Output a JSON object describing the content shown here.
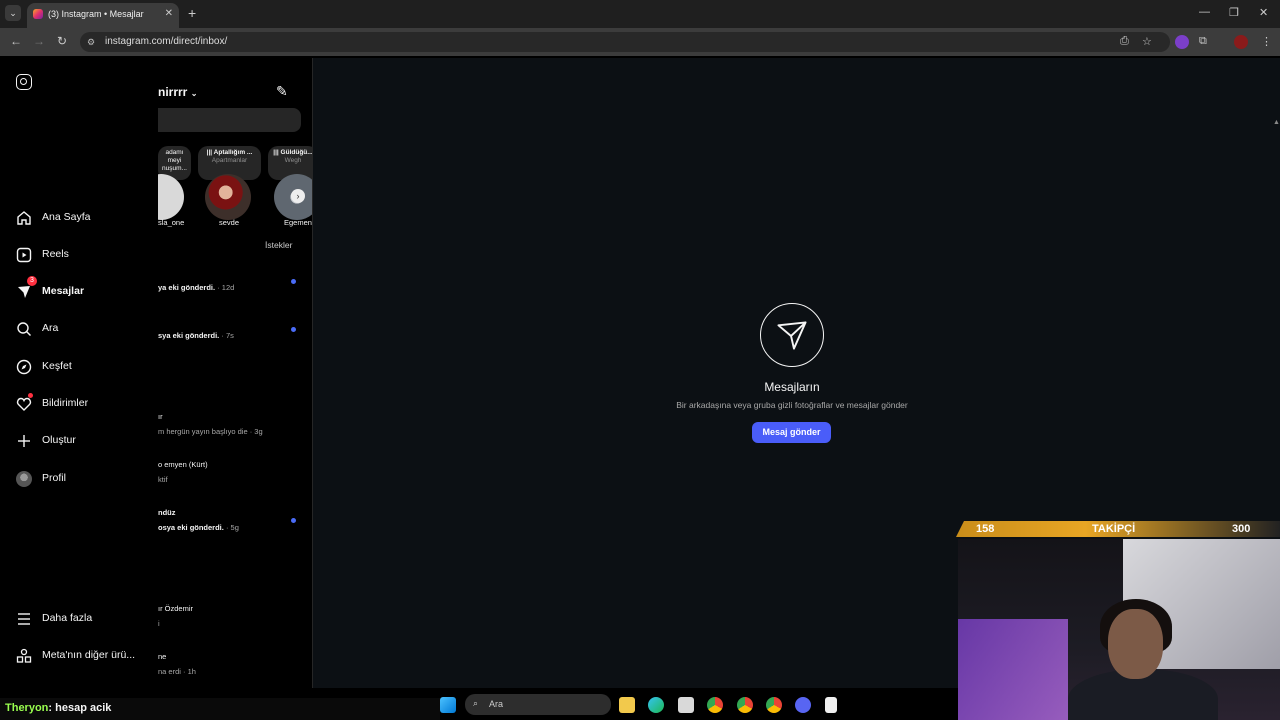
{
  "browser": {
    "tab_title": "(3) Instagram • Mesajlar",
    "url": "instagram.com/direct/inbox/",
    "tab_close": "✕",
    "new_tab": "+",
    "minimize": "—",
    "maximize": "❐",
    "close": "✕"
  },
  "sidebar": {
    "items": [
      {
        "label": "Ana Sayfa",
        "icon": "home-icon"
      },
      {
        "label": "Reels",
        "icon": "reels-icon"
      },
      {
        "label": "Mesajlar",
        "icon": "messenger-icon",
        "badge": "3"
      },
      {
        "label": "Ara",
        "icon": "search-icon"
      },
      {
        "label": "Keşfet",
        "icon": "explore-icon"
      },
      {
        "label": "Bildirimler",
        "icon": "heart-icon"
      },
      {
        "label": "Oluştur",
        "icon": "plus-icon"
      },
      {
        "label": "Profil",
        "icon": "avatar"
      }
    ],
    "more": "Daha fazla",
    "meta": "Meta'nın diğer ürü..."
  },
  "messages": {
    "username": "nirrrr",
    "requests": "İstekler",
    "notes": [
      {
        "title": "adamı",
        "sub": "meyi\nnuşum..."
      },
      {
        "title": "|​|| Aptallığım ...",
        "sub": "Apartmanlar"
      },
      {
        "title": "|​|| Güldüğü...",
        "sub": "Wegh"
      }
    ],
    "stories": [
      {
        "name": "sla_one"
      },
      {
        "name": "sevde"
      },
      {
        "name": "Egemen"
      }
    ],
    "threads": [
      {
        "line1": "",
        "line2": "",
        "preview": "ya eki gönderdi.",
        "time": " · 12d",
        "unread": true
      },
      {
        "line1": "",
        "line2": "",
        "preview": "sya eki gönderdi.",
        "time": " · 7s",
        "unread": true
      },
      {
        "line1": "ır",
        "line2": "m hergün yayın başlıyo die",
        "time": " · 3g",
        "unread": false
      },
      {
        "line1": "o emyen (Kürt)",
        "line2": "ktif",
        "time": "",
        "unread": false
      },
      {
        "line1": "ndüz",
        "line2": "",
        "preview": "osya eki gönderdi.",
        "time": " · 5g",
        "unread": true
      },
      {
        "line1": "ır Özdemir",
        "line2": "i",
        "time": "",
        "unread": false
      },
      {
        "line1": "ne",
        "line2": "na erdi",
        "time": " · 1h",
        "unread": false
      }
    ]
  },
  "main": {
    "title": "Mesajların",
    "subtitle": "Bir arkadaşına veya gruba gizli fotoğraflar ve mesajlar gönder",
    "button": "Mesaj gönder"
  },
  "overlay": {
    "follower_current": "158",
    "follower_label": "TAKİPÇİ",
    "follower_goal": "300",
    "chat_user": "Theryon",
    "chat_message": ": hesap acik"
  },
  "taskbar": {
    "search_placeholder": "Ara"
  }
}
